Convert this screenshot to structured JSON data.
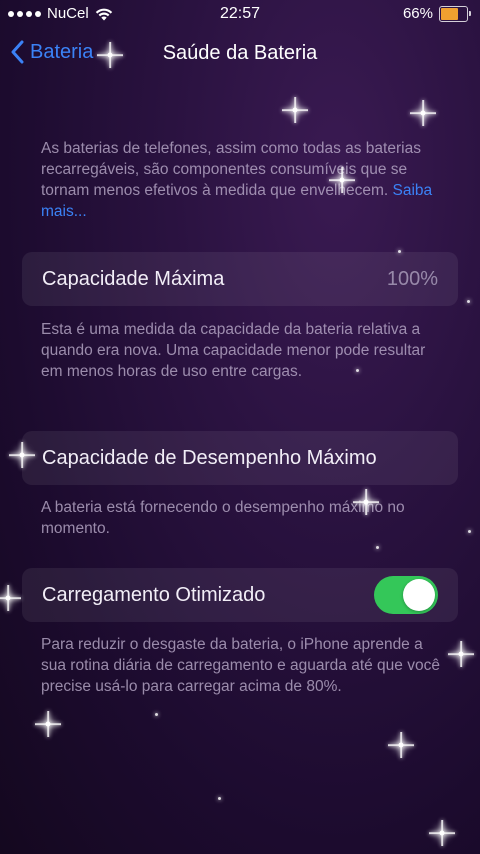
{
  "status_bar": {
    "carrier": "NuCel",
    "time": "22:57",
    "battery_percent": "66%",
    "battery_level": 0.66,
    "icons": [
      "signal-dots-icon",
      "wifi-icon",
      "battery-icon"
    ]
  },
  "nav": {
    "back_label": "Bateria",
    "title": "Saúde da Bateria"
  },
  "intro": {
    "text": "As baterias de telefones, assim como todas as baterias recarregáveis, são componentes consumíveis que se tornam menos efetivos à medida que envelhecem. ",
    "link": "Saiba mais..."
  },
  "max_capacity": {
    "label": "Capacidade Máxima",
    "value": "100%",
    "footer": "Esta é uma medida da capacidade da bateria relativa a quando era nova. Uma capacidade menor pode resultar em menos horas de uso entre cargas."
  },
  "peak_performance": {
    "label": "Capacidade de Desempenho Máximo",
    "footer": "A bateria está fornecendo o desempenho máximo no momento."
  },
  "optimized_charging": {
    "label": "Carregamento Otimizado",
    "enabled": true,
    "footer": "Para reduzir o desgaste da bateria, o iPhone aprende a sua rotina diária de carregamento e aguarda até que você precise usá-lo para carregar acima de 80%."
  },
  "colors": {
    "accent": "#3b82f6",
    "toggle_on": "#34c759",
    "battery_fill": "#f0a030",
    "background": "#1c0b2e"
  }
}
